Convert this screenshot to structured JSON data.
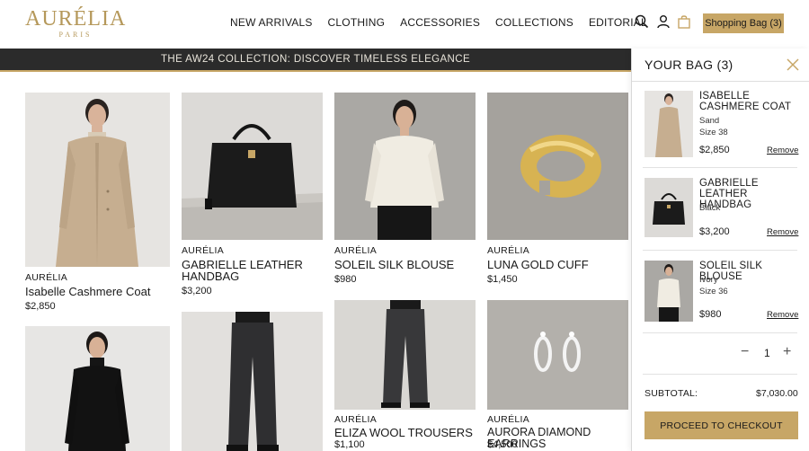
{
  "brand": {
    "logo_main": "AURÉLIA",
    "logo_sub": "PARIS",
    "accent": "#c7a666",
    "dark": "#2b2b2b"
  },
  "nav": {
    "items": [
      "NEW ARRIVALS",
      "CLOTHING",
      "ACCESSORIES",
      "COLLECTIONS",
      "EDITORIAL"
    ],
    "icons": [
      "search-icon",
      "account-icon",
      "bag-icon"
    ],
    "bag_button": "Shopping Bag (3)"
  },
  "banner": {
    "text": "THE AW24 COLLECTION: DISCOVER TIMELESS ELEGANCE"
  },
  "products": [
    {
      "brand": "AURÉLIA",
      "name": "Isabelle Cashmere Coat",
      "price": "$2,850"
    },
    {
      "brand": "AURÉLIA",
      "name": "GABRIELLE LEATHER HANDBAG",
      "price": "$3,200"
    },
    {
      "brand": "AURÉLIA",
      "name": "SOLEIL SILK BLOUSE",
      "price": "$980"
    },
    {
      "brand": "AURÉLIA",
      "name": "LUNA GOLD CUFF",
      "price": "$1,450"
    },
    {
      "brand": "",
      "name": "",
      "price": ""
    },
    {
      "brand": "",
      "name": "",
      "price": ""
    },
    {
      "brand": "AURÉLIA",
      "name": "ELIZA WOOL TROUSERS",
      "price": "$1,100"
    },
    {
      "brand": "AURÉLIA",
      "name": "AURORA DIAMOND EARRINGS",
      "price": "$4,500"
    }
  ],
  "cart": {
    "title": "YOUR BAG (3)",
    "items": [
      {
        "name": "ISABELLE CASHMERE COAT",
        "color": "Sand",
        "size": "Size 38",
        "price": "$2,850",
        "remove": "Remove"
      },
      {
        "name": "GABRIELLE LEATHER HANDBAG",
        "color": "Black",
        "size": "",
        "price": "$3,200",
        "remove": "Remove"
      },
      {
        "name": "SOLEIL SILK BLOUSE",
        "color": "Ivory",
        "size": "Size 36",
        "price": "$980",
        "remove": "Remove"
      }
    ],
    "quantity": "1",
    "minus": "−",
    "plus": "+",
    "subtotal_label": "SUBTOTAL:",
    "subtotal_value": "$7,030.00",
    "checkout": "PROCEED TO CHECKOUT"
  }
}
